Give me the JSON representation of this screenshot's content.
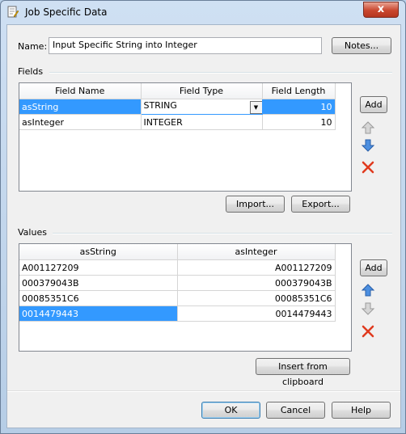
{
  "window": {
    "title": "Job Specific Data",
    "close_glyph": "x"
  },
  "name": {
    "label": "Name:",
    "value": "Input Specific String into Integer"
  },
  "notes_button": "Notes...",
  "fields": {
    "group_label": "Fields",
    "headers": [
      "Field Name",
      "Field Type",
      "Field Length"
    ],
    "rows": [
      {
        "name": "asString",
        "type": "STRING",
        "length": "10"
      },
      {
        "name": "asInteger",
        "type": "INTEGER",
        "length": "10"
      }
    ],
    "add_button": "Add",
    "import_button": "Import...",
    "export_button": "Export..."
  },
  "values": {
    "group_label": "Values",
    "headers": [
      "asString",
      "asInteger"
    ],
    "rows": [
      [
        "A001127209",
        "A001127209"
      ],
      [
        "000379043B",
        "000379043B"
      ],
      [
        "00085351C6",
        "00085351C6"
      ],
      [
        "0014479443",
        "0014479443"
      ]
    ],
    "add_button": "Add",
    "insert_button": "Insert from clipboard"
  },
  "footer": {
    "ok": "OK",
    "cancel": "Cancel",
    "help": "Help"
  },
  "colors": {
    "selection": "#3399ff",
    "up_arrow": "#3a7bd5",
    "delete": "#e03a1e"
  }
}
